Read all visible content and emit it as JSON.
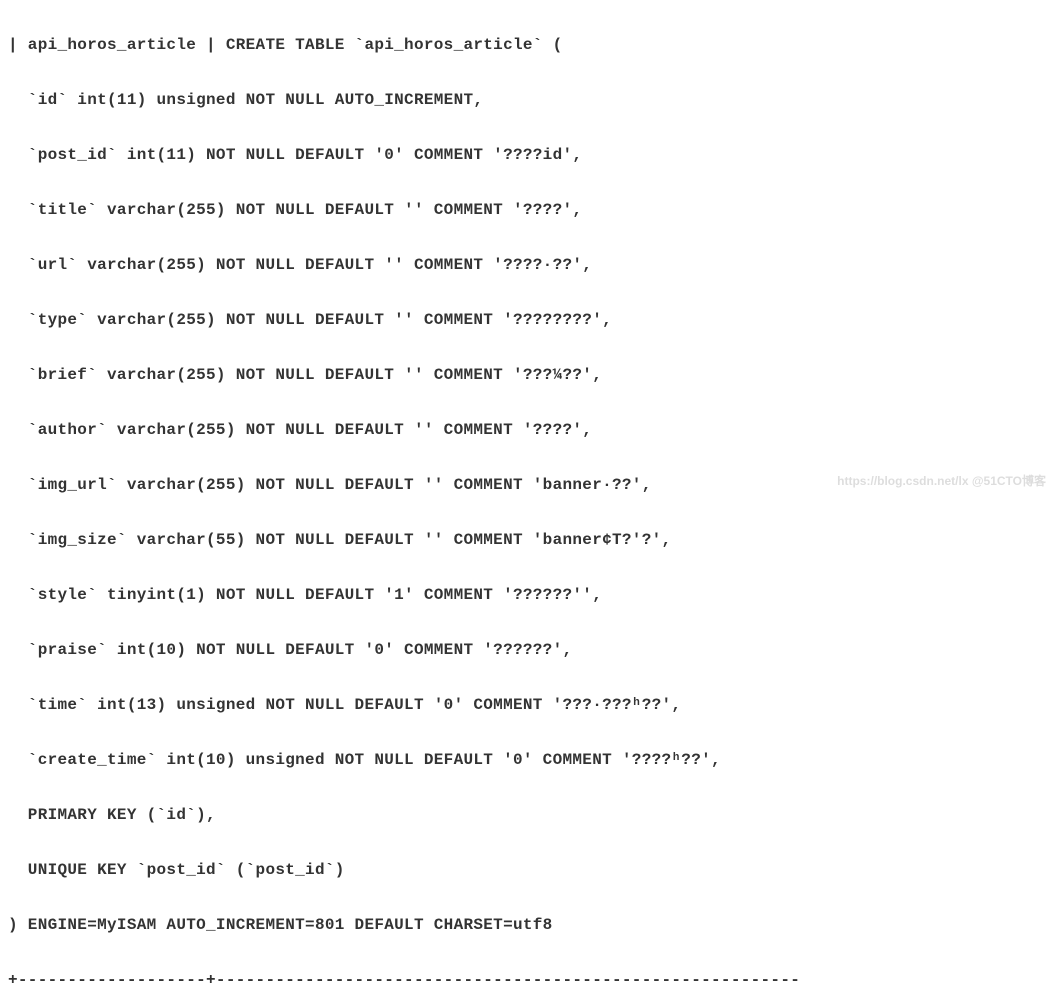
{
  "lines": [
    "| api_horos_article | CREATE TABLE `api_horos_article` (",
    "  `id` int(11) unsigned NOT NULL AUTO_INCREMENT,",
    "  `post_id` int(11) NOT NULL DEFAULT '0' COMMENT '????id',",
    "  `title` varchar(255) NOT NULL DEFAULT '' COMMENT '????',",
    "  `url` varchar(255) NOT NULL DEFAULT '' COMMENT '????·??',",
    "  `type` varchar(255) NOT NULL DEFAULT '' COMMENT '????????',",
    "  `brief` varchar(255) NOT NULL DEFAULT '' COMMENT '???¼??',",
    "  `author` varchar(255) NOT NULL DEFAULT '' COMMENT '????',",
    "  `img_url` varchar(255) NOT NULL DEFAULT '' COMMENT 'banner·??',",
    "  `img_size` varchar(55) NOT NULL DEFAULT '' COMMENT 'banner¢T?'?',",
    "  `style` tinyint(1) NOT NULL DEFAULT '1' COMMENT '??????'',",
    "  `praise` int(10) NOT NULL DEFAULT '0' COMMENT '??????',",
    "  `time` int(13) unsigned NOT NULL DEFAULT '0' COMMENT '???·???ʰ??',",
    "  `create_time` int(10) unsigned NOT NULL DEFAULT '0' COMMENT '????ʰ??',",
    "  PRIMARY KEY (`id`),",
    "  UNIQUE KEY `post_id` (`post_id`)",
    ") ENGINE=MyISAM AUTO_INCREMENT=801 DEFAULT CHARSET=utf8",
    "+-------------------+-----------------------------------------------------------"
  ],
  "watermark": "https://blog.csdn.net/lx  @51CTO博客"
}
